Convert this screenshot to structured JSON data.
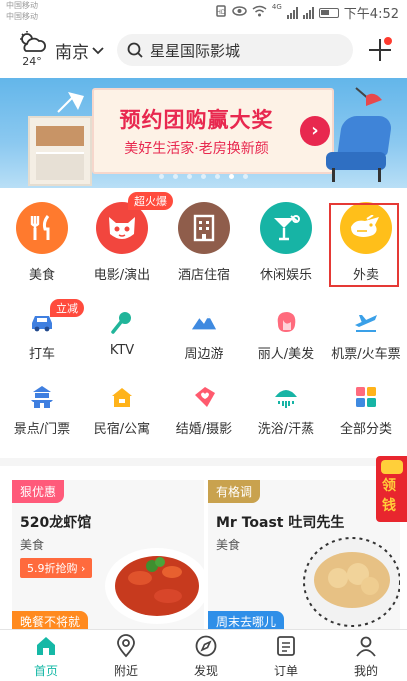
{
  "status_bar": {
    "carrier_1": "中国移动",
    "carrier_2": "中国移动",
    "network": "4G",
    "time": "下午4:52"
  },
  "header": {
    "temperature": "24°",
    "city": "南京",
    "search_text": "星星国际影城"
  },
  "banner": {
    "title": "预约团购赢大奖",
    "subtitle": "美好生活家·老房换新颜",
    "arrow": "›",
    "page_dots": 7,
    "active_dot": 5
  },
  "main_categories": [
    {
      "label": "美食",
      "color": "#ff7a2e",
      "icon": "fork-knife-icon"
    },
    {
      "label": "电影/演出",
      "color": "#f2463e",
      "icon": "cat-mascot-icon",
      "badge": "超火爆"
    },
    {
      "label": "酒店住宿",
      "color": "#8f5d4b",
      "icon": "building-icon"
    },
    {
      "label": "休闲娱乐",
      "color": "#17b4a5",
      "icon": "cocktail-icon"
    },
    {
      "label": "外卖",
      "color": "#ffbf1a",
      "icon": "delivery-rabbit-icon"
    }
  ],
  "sub_categories_row1": [
    {
      "label": "打车",
      "icon": "car-icon",
      "color": "#3f7fe0",
      "badge": "立减"
    },
    {
      "label": "KTV",
      "icon": "microphone-icon",
      "color": "#21b59a"
    },
    {
      "label": "周边游",
      "icon": "mountain-icon",
      "color": "#3f8ae0"
    },
    {
      "label": "丽人/美发",
      "icon": "woman-hair-icon",
      "color": "#ff6b7d"
    },
    {
      "label": "机票/火车票",
      "icon": "plane-icon",
      "color": "#3aa0e8"
    }
  ],
  "sub_categories_row2": [
    {
      "label": "景点/门票",
      "icon": "temple-icon",
      "color": "#3f7fe0"
    },
    {
      "label": "民宿/公寓",
      "icon": "house-icon",
      "color": "#ffb31a"
    },
    {
      "label": "结婚/摄影",
      "icon": "heart-tag-icon",
      "color": "#ff5a6e"
    },
    {
      "label": "洗浴/汗蒸",
      "icon": "shower-icon",
      "color": "#17b4a5"
    },
    {
      "label": "全部分类",
      "icon": "grid-icon",
      "color": "#3f8ae0"
    }
  ],
  "deals": [
    {
      "tag": "狠优惠",
      "tag_color": "#ff5a7a",
      "title": "520龙虾馆",
      "category": "美食",
      "price": "5.9折抢购 ›",
      "bottom_tag": "晚餐不将就",
      "bottom_color": "#ff8a1f"
    },
    {
      "tag": "有格调",
      "tag_color": "#c9a24e",
      "title": "Mr Toast 吐司先生",
      "category": "美食",
      "bottom_tag": "周末去哪儿",
      "bottom_color": "#2f8fe8"
    }
  ],
  "red_packet_text": "领钱",
  "tabs": [
    {
      "label": "首页",
      "icon": "home-icon",
      "active": true
    },
    {
      "label": "附近",
      "icon": "location-pin-icon",
      "active": false
    },
    {
      "label": "发现",
      "icon": "compass-icon",
      "active": false
    },
    {
      "label": "订单",
      "icon": "order-list-icon",
      "active": false
    },
    {
      "label": "我的",
      "icon": "user-icon",
      "active": false
    }
  ],
  "accent_color": "#15b8a6"
}
